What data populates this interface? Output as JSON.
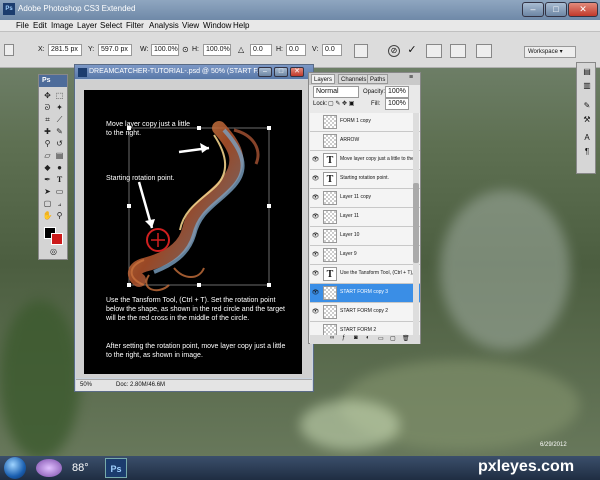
{
  "app": {
    "title": "Adobe Photoshop CS3 Extended",
    "icon": "Ps"
  },
  "menu": [
    "File",
    "Edit",
    "Image",
    "Layer",
    "Select",
    "Filter",
    "Analysis",
    "View",
    "Window",
    "Help"
  ],
  "options": {
    "x_label": "X:",
    "x_value": "281.5 px",
    "y_label": "Y:",
    "y_value": "597.0 px",
    "w_label": "W:",
    "w_value": "100.0%",
    "h_label": "H:",
    "h_value": "100.0%",
    "angle_value": "0.0",
    "h_skew_label": "H:",
    "h_skew_value": "0.0",
    "v_skew_label": "V:",
    "v_skew_value": "0.0",
    "workspace_label": "Workspace"
  },
  "toolbox": {
    "header": "Ps"
  },
  "document": {
    "title": "DREAMCATCHER-TUTORIAL-.psd @ 50% (START F...",
    "zoom": "50%",
    "doc_size": "Doc: 2.80M/46.6M",
    "canvas_texts": {
      "move_note": "Move layer copy just a little to the right.",
      "rotation_note": "Starting rotation point.",
      "transform_instructions": "Use the Tansform Tool, (Ctrl + T). Set the rotation point below the shape, as shown in the red circle and the target will be the red cross in the middle of the circle.",
      "after_instructions": "After setting the rotation point, move layer copy just a little to the right, as shown in image."
    }
  },
  "layers_panel": {
    "tabs": [
      "Layers",
      "Channels",
      "Paths"
    ],
    "blend_mode": "Normal",
    "opacity_label": "Opacity:",
    "opacity_value": "100%",
    "lock_label": "Lock:",
    "fill_label": "Fill:",
    "fill_value": "100%",
    "layers": [
      {
        "name": "FORM 1 copy",
        "visible": false,
        "type": "pixel",
        "selected": false
      },
      {
        "name": "ARROW",
        "visible": false,
        "type": "pixel",
        "selected": false
      },
      {
        "name": "Move layer copy just a little to the rignt...",
        "visible": true,
        "type": "text",
        "selected": false
      },
      {
        "name": "Starting rotation point.",
        "visible": true,
        "type": "text",
        "selected": false
      },
      {
        "name": "Layer 11 copy",
        "visible": true,
        "type": "pixel",
        "selected": false
      },
      {
        "name": "Layer 11",
        "visible": true,
        "type": "pixel",
        "selected": false
      },
      {
        "name": "Layer 10",
        "visible": true,
        "type": "pixel",
        "selected": false
      },
      {
        "name": "Layer 9",
        "visible": true,
        "type": "pixel",
        "selected": false
      },
      {
        "name": "Use the Tansform Tool, (Ctrl + T), Set ...",
        "visible": true,
        "type": "text",
        "selected": false
      },
      {
        "name": "START FORM copy 3",
        "visible": true,
        "type": "pixel",
        "selected": true
      },
      {
        "name": "START FORM copy 2",
        "visible": true,
        "type": "pixel",
        "selected": false
      },
      {
        "name": "START FORM 2",
        "visible": false,
        "type": "pixel",
        "selected": false
      }
    ]
  },
  "taskbar": {
    "weather": "88°",
    "ps_label": "Ps",
    "date": "6/29/2012"
  },
  "watermark": "pxleyes.com",
  "colors": {
    "selected_layer": "#3a8ee6",
    "canvas_bg": "#000000",
    "foreground_swatch": "#000000",
    "background_swatch": "#cc1a1a"
  }
}
